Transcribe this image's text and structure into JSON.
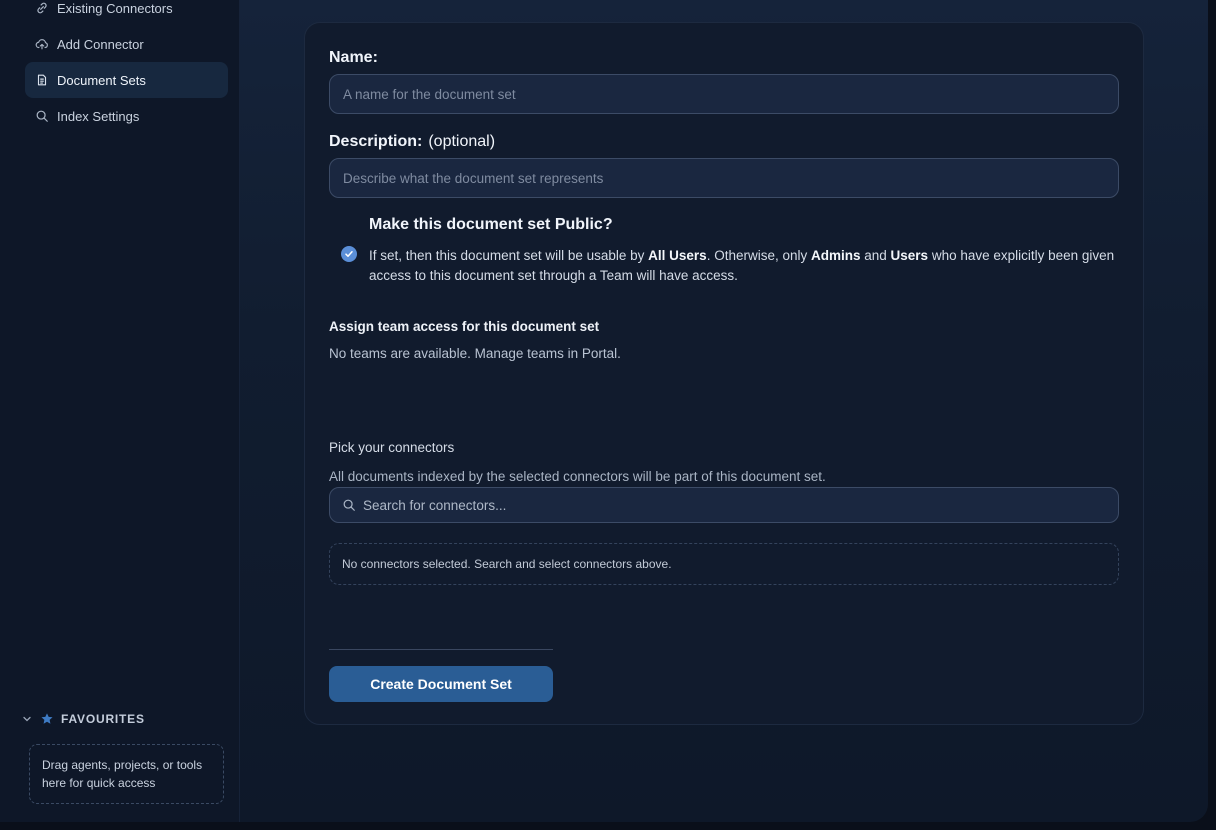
{
  "sidebar": {
    "items": [
      {
        "label": "Existing Connectors",
        "icon": "link-icon"
      },
      {
        "label": "Add Connector",
        "icon": "cloud-upload-icon"
      },
      {
        "label": "Document Sets",
        "icon": "document-icon",
        "active": true
      },
      {
        "label": "Index Settings",
        "icon": "search-icon"
      }
    ],
    "favourites": {
      "title": "FAVOURITES",
      "drop_hint": "Drag agents, projects, or tools here for quick access"
    }
  },
  "form": {
    "name_label": "Name:",
    "name_placeholder": "A name for the document set",
    "name_value": "",
    "description_label": "Description:",
    "description_optional": "(optional)",
    "description_placeholder": "Describe what the document set represents",
    "description_value": "",
    "public": {
      "title": "Make this document set Public?",
      "checked": true,
      "desc_part1": "If set, then this document set will be usable by ",
      "desc_bold1": "All Users",
      "desc_part2": ". Otherwise, only ",
      "desc_bold2": "Admins",
      "desc_part3": " and ",
      "desc_bold3": "Users",
      "desc_part4": " who have explicitly been given access to this document set through a Team will have access."
    },
    "teams": {
      "title": "Assign team access for this document set",
      "note": "No teams are available. Manage teams in Portal."
    },
    "connectors": {
      "title": "Pick your connectors",
      "description": "All documents indexed by the selected connectors will be part of this document set.",
      "search_placeholder": "Search for connectors...",
      "empty_message": "No connectors selected. Search and select connectors above."
    },
    "submit_label": "Create Document Set"
  },
  "colors": {
    "accent": "#2a5d95",
    "check": "#5b8fd8",
    "card_bg": "#111b2d",
    "sidebar_bg": "#0e1728"
  }
}
